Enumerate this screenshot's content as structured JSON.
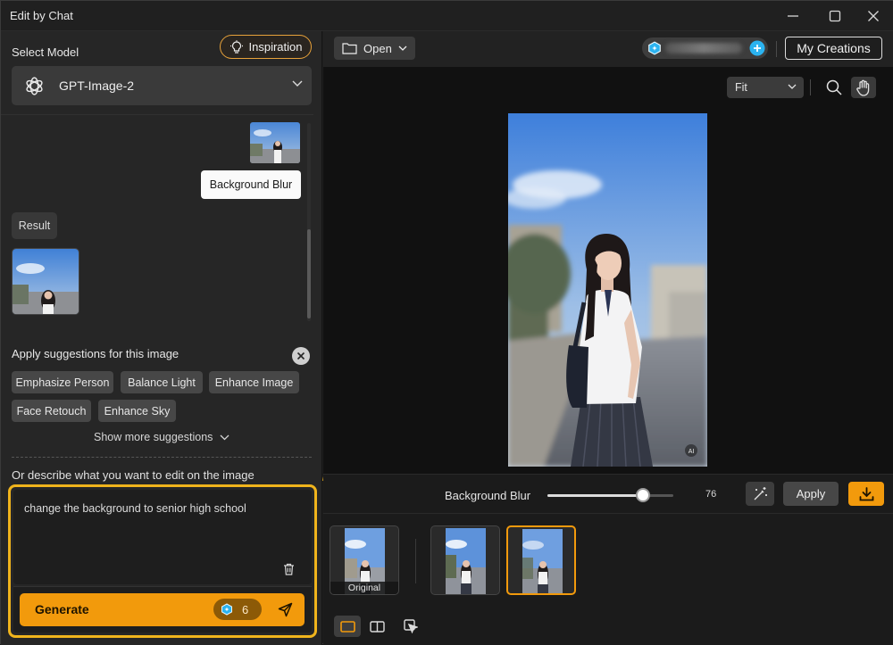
{
  "window": {
    "title": "Edit by Chat"
  },
  "left": {
    "select_model_label": "Select Model",
    "inspiration_label": "Inspiration",
    "model_name": "GPT-Image-2",
    "chat": {
      "user_message": "Background Blur",
      "result_label": "Result"
    },
    "suggestions": {
      "title": "Apply suggestions for this image",
      "chips": [
        "Emphasize Person",
        "Balance Light",
        "Enhance Image",
        "Face Retouch",
        "Enhance Sky"
      ],
      "show_more": "Show more suggestions"
    },
    "describe_label": "Or describe what you want to edit on the image",
    "prompt_text": "change the background to senior high school",
    "generate_label": "Generate",
    "credit_cost": "6"
  },
  "right": {
    "open_label": "Open",
    "my_creations_label": "My Creations",
    "fit_label": "Fit",
    "effect_label": "Background Blur",
    "slider_value": "76",
    "slider_fraction": 0.76,
    "apply_label": "Apply",
    "thumbs": [
      {
        "caption": "Original",
        "selected": false
      },
      {
        "caption": "",
        "selected": false
      },
      {
        "caption": "",
        "selected": true
      }
    ],
    "ai_badge": "AI"
  },
  "colors": {
    "accent": "#f29a0c",
    "highlight": "#f0b41c"
  },
  "icons": [
    "minimize-icon",
    "maximize-icon",
    "close-icon",
    "lightbulb-icon",
    "openai-logo-icon",
    "chevron-down-icon",
    "trash-icon",
    "credit-icon",
    "send-icon",
    "folder-icon",
    "plus-icon",
    "zoom-icon",
    "hand-icon",
    "magic-wand-icon",
    "download-icon",
    "single-view-icon",
    "split-view-icon",
    "compare-icon"
  ]
}
